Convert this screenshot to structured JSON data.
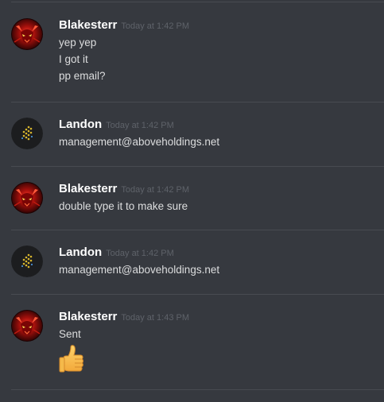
{
  "messages": [
    {
      "author": "Blakesterr",
      "avatar_icon": "red-demon-avatar",
      "timestamp": "Today at 1:42 PM",
      "lines": [
        "yep yep",
        "I got it",
        "pp email?"
      ]
    },
    {
      "author": "Landon",
      "avatar_icon": "dotted-logo-avatar",
      "timestamp": "Today at 1:42 PM",
      "lines": [
        "management@aboveholdings.net"
      ]
    },
    {
      "author": "Blakesterr",
      "avatar_icon": "red-demon-avatar",
      "timestamp": "Today at 1:42 PM",
      "lines": [
        "double type it to make sure"
      ]
    },
    {
      "author": "Landon",
      "avatar_icon": "dotted-logo-avatar",
      "timestamp": "Today at 1:42 PM",
      "lines": [
        "management@aboveholdings.net"
      ]
    },
    {
      "author": "Blakesterr",
      "avatar_icon": "red-demon-avatar",
      "timestamp": "Today at 1:43 PM",
      "lines": [
        "Sent"
      ],
      "emoji": "thumbs-up-emoji"
    }
  ],
  "colors": {
    "background": "#36393f",
    "username": "#ffffff",
    "timestamp": "#5e6269",
    "message_text": "#dcddde",
    "divider": "#484b51"
  }
}
